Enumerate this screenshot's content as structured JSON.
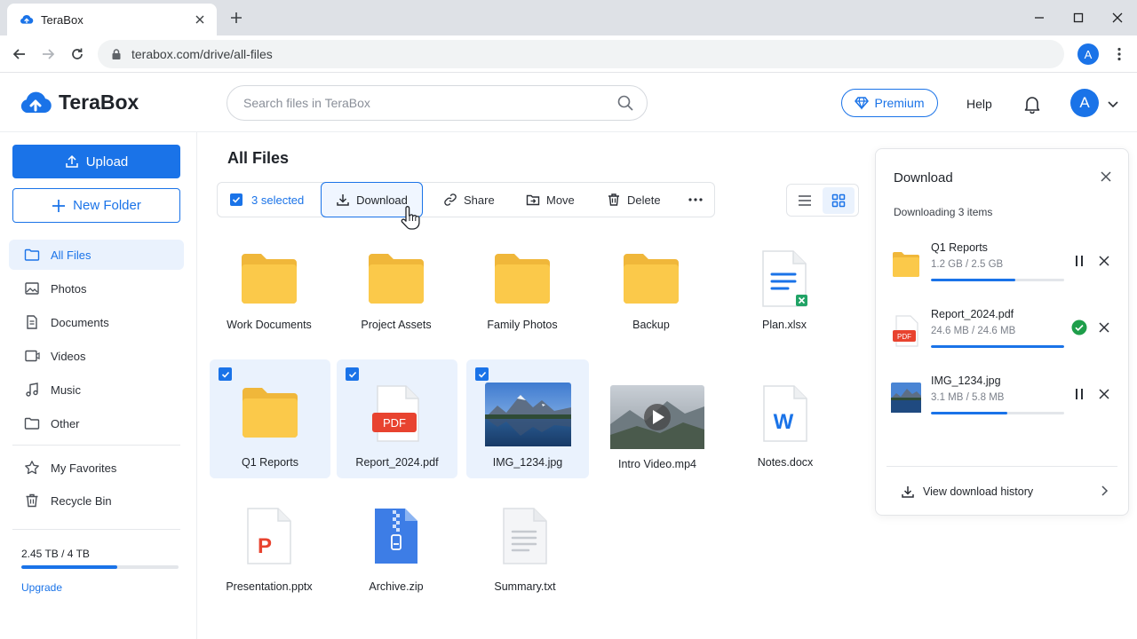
{
  "browser": {
    "tab_title": "TeraBox",
    "url": "terabox.com/drive/all-files",
    "profile_initial": "A"
  },
  "header": {
    "brand": "TeraBox",
    "search_placeholder": "Search files in TeraBox",
    "premium_label": "Premium",
    "help_label": "Help",
    "avatar_initial": "A"
  },
  "sidebar": {
    "upload_label": "Upload",
    "new_folder_label": "New Folder",
    "items": [
      {
        "label": "All Files",
        "icon": "folder-icon",
        "active": true
      },
      {
        "label": "Photos",
        "icon": "image-icon"
      },
      {
        "label": "Documents",
        "icon": "document-icon"
      },
      {
        "label": "Videos",
        "icon": "video-icon"
      },
      {
        "label": "Music",
        "icon": "music-icon"
      },
      {
        "label": "Other",
        "icon": "folder-icon"
      },
      {
        "label": "My Favorites",
        "icon": "star-icon"
      },
      {
        "label": "Recycle Bin",
        "icon": "trash-icon"
      }
    ],
    "storage_text": "2.45 TB / 4 TB",
    "storage_fraction": 0.6125,
    "upgrade_label": "Upgrade"
  },
  "main": {
    "title": "All Files",
    "toolbar": {
      "selected_label": "3 selected",
      "download_label": "Download",
      "share_label": "Share",
      "move_label": "Move",
      "delete_label": "Delete"
    },
    "files": [
      {
        "name": "Work Documents",
        "type": "folder",
        "selected": false
      },
      {
        "name": "Project Assets",
        "type": "folder",
        "selected": false
      },
      {
        "name": "Family Photos",
        "type": "folder",
        "selected": false
      },
      {
        "name": "Backup",
        "type": "folder",
        "selected": false
      },
      {
        "name": "Plan.xlsx",
        "type": "xlsx",
        "selected": false
      },
      {
        "name": "Q1 Reports",
        "type": "folder",
        "selected": true
      },
      {
        "name": "Report_2024.pdf",
        "type": "pdf",
        "selected": true,
        "badge": "PDF"
      },
      {
        "name": "IMG_1234.jpg",
        "type": "image",
        "selected": true
      },
      {
        "name": "Intro Video.mp4",
        "type": "video",
        "selected": false
      },
      {
        "name": "Notes.docx",
        "type": "docx",
        "selected": false,
        "badge": "W"
      },
      {
        "name": "Presentation.pptx",
        "type": "pptx",
        "selected": false,
        "badge": "P"
      },
      {
        "name": "Archive.zip",
        "type": "zip",
        "selected": false
      },
      {
        "name": "Summary.txt",
        "type": "txt",
        "selected": false
      }
    ]
  },
  "download_panel": {
    "title": "Download",
    "subtitle": "Downloading 3 items",
    "items": [
      {
        "name": "Q1 Reports",
        "size": "1.2 GB / 2.5 GB",
        "progress": 0.63,
        "status": "downloading"
      },
      {
        "name": "Report_2024.pdf",
        "size": "24.6 MB / 24.6 MB",
        "progress": 1.0,
        "status": "complete",
        "badge": "PDF"
      },
      {
        "name": "IMG_1234.jpg",
        "size": "3.1 MB / 5.8 MB",
        "progress": 0.57,
        "status": "downloading"
      }
    ],
    "history_label": "View download history"
  },
  "colors": {
    "accent": "#1a73e8",
    "folder": "#fbc94a",
    "selected_bg": "#eaf2fd",
    "success": "#1e9e4a",
    "pdf_red": "#e8432f"
  }
}
